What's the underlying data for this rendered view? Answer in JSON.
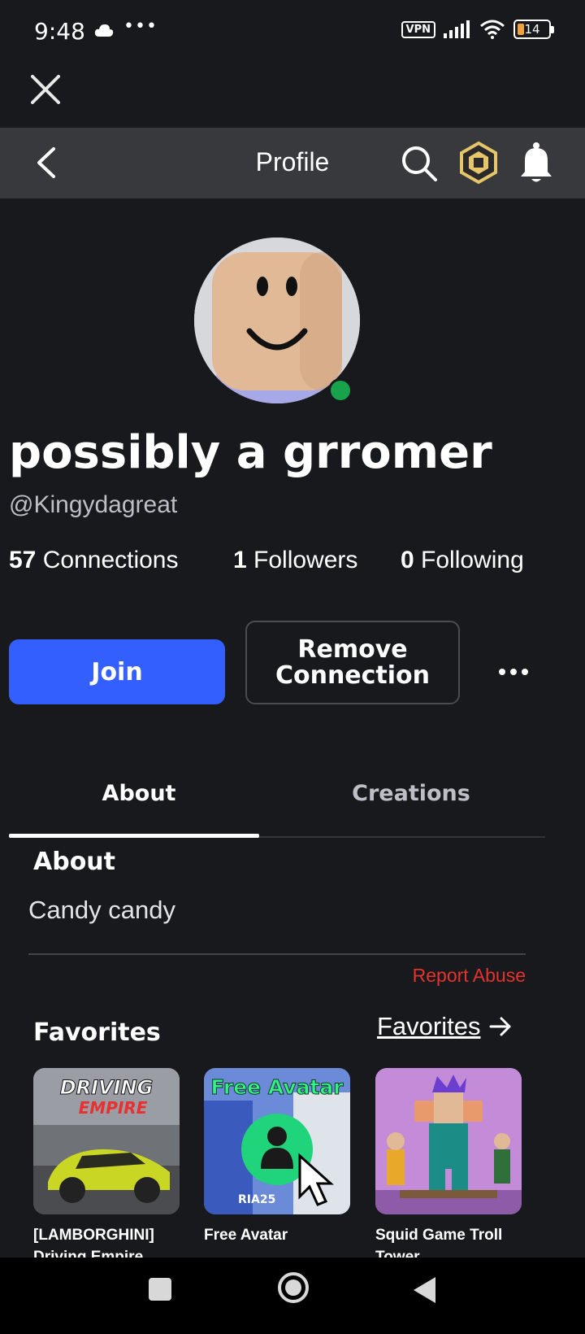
{
  "status_bar": {
    "time": "9:48",
    "dots": "•••",
    "vpn": "VPN",
    "battery": "14"
  },
  "nav": {
    "title": "Profile"
  },
  "profile": {
    "display_name": "possibly a grromer",
    "username": "@Kingydagreat",
    "online": true,
    "connections_count": "57",
    "connections_label": "Connections",
    "followers_count": "1",
    "followers_label": "Followers",
    "following_count": "0",
    "following_label": "Following"
  },
  "actions": {
    "join": "Join",
    "remove_line1": "Remove",
    "remove_line2": "Connection"
  },
  "tabs": [
    {
      "label": "About",
      "active": true
    },
    {
      "label": "Creations",
      "active": false
    }
  ],
  "about": {
    "heading": "About",
    "text": "Candy candy",
    "report": "Report Abuse"
  },
  "favorites": {
    "heading": "Favorites",
    "link": "Favorites",
    "items": [
      {
        "title": "[LAMBORGHINI] Driving Empire",
        "thumb_text1": "DRIVING",
        "thumb_text2": "EMPIRE"
      },
      {
        "title": "Free Avatar",
        "thumb_text1": "Free Avatar",
        "thumb_text2": "RIA25"
      },
      {
        "title": "Squid Game Troll Tower"
      }
    ]
  },
  "colors": {
    "background": "#18191c",
    "nav_bar": "#38393d",
    "join_button": "#335fff",
    "online": "#19a24c",
    "report": "#e5322d"
  }
}
